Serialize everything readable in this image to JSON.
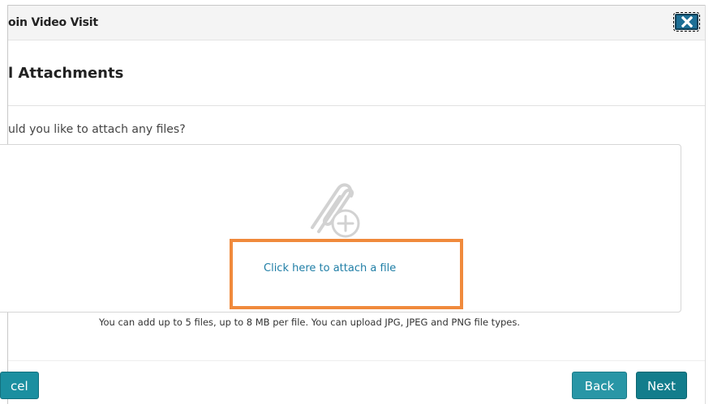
{
  "dialog": {
    "title": "oin Video Visit",
    "close_icon": "close-icon"
  },
  "step": {
    "heading": "l Attachments",
    "question": "uld you like to attach any files?"
  },
  "upload": {
    "icon": "paperclip-plus-icon",
    "link_label": "Click here to attach a file",
    "note": "You can add up to 5 files, up to 8 MB per file. You can upload JPG, JPEG and PNG file types.",
    "highlight_color": "#f08a3c"
  },
  "footer": {
    "cancel_label": "cel",
    "back_label": "Back",
    "next_label": "Next"
  },
  "colors": {
    "button": "#1b8fa0",
    "link": "#1f7ea6",
    "close_button": "#1d6f96"
  }
}
